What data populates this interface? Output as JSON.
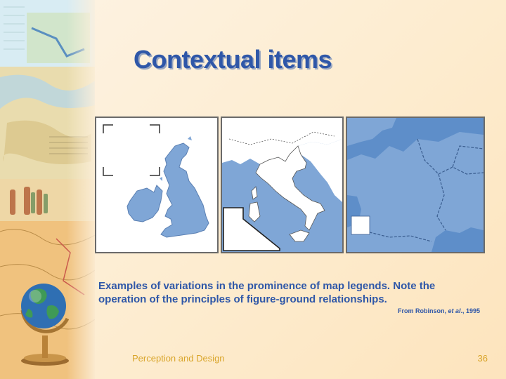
{
  "slide": {
    "title": "Contextual items",
    "caption": "Examples of variations in the prominence of map legends. Note the operation of the principles of figure-ground relationships.",
    "credit_prefix": "From Robinson, ",
    "credit_italic": "et al",
    "credit_suffix": "., 1995",
    "footer_left": "Perception and Design",
    "page_number": "36"
  },
  "colors": {
    "title": "#2f57a8",
    "land_blue": "#7fa6d6",
    "sea_blue": "#6e98cf",
    "footer": "#d9a52a"
  },
  "icons": [
    "globe-icon"
  ]
}
